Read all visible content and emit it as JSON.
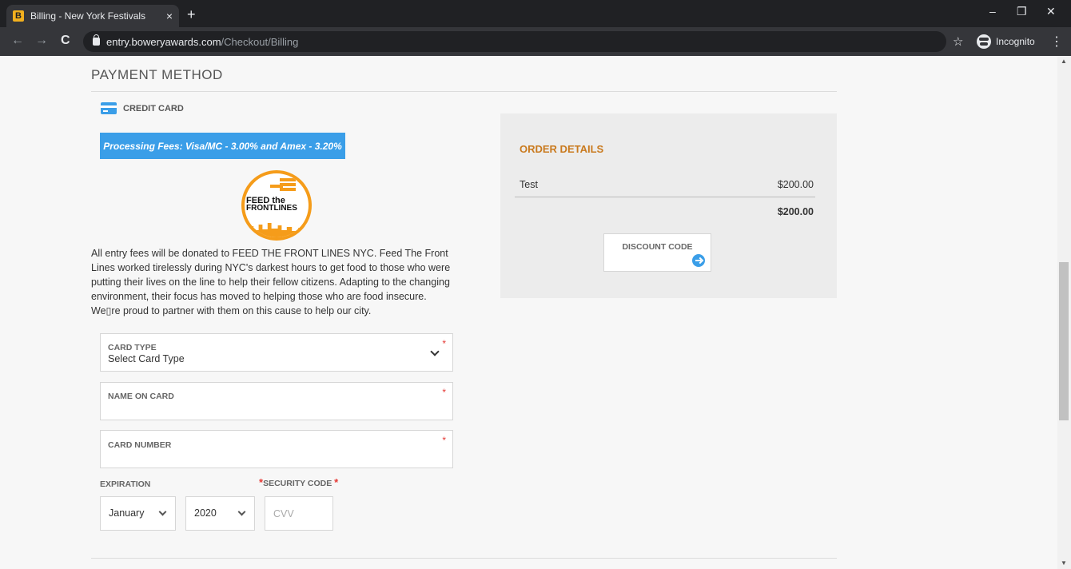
{
  "browser": {
    "tab_title": "Billing - New York Festivals",
    "favicon_letter": "B",
    "tab_close": "×",
    "new_tab": "+",
    "url_host": "entry.boweryawards.com",
    "url_path": "/Checkout/Billing",
    "incognito_label": "Incognito",
    "minimize": "–",
    "maximize": "❐",
    "close": "✕",
    "back": "←",
    "forward": "→",
    "reload": "C",
    "star": "☆",
    "menu": "⋮"
  },
  "payment": {
    "section_title": "PAYMENT METHOD",
    "method_label": "CREDIT CARD",
    "fee_banner": "Processing Fees: Visa/MC - 3.00% and Amex - 3.20%",
    "logo_line1": "FEED the",
    "logo_line2": "FRONTLINES",
    "donation_text": "All entry fees will be donated to FEED THE FRONT LINES NYC. Feed The Front Lines worked tirelessly during NYC's darkest hours to get food to those who were putting their lives on the line to help their fellow citizens. Adapting to the changing environment, their focus has moved to helping those who are food insecure. We▯re proud to partner with them on this cause to help our city.",
    "card_type_label": "CARD TYPE",
    "card_type_value": "Select Card Type",
    "name_label": "NAME ON CARD",
    "number_label": "CARD NUMBER",
    "required_mark": "*",
    "expiration_label": "EXPIRATION",
    "security_label": "SECURITY CODE",
    "month_value": "January",
    "year_value": "2020",
    "cvv_placeholder": "CVV"
  },
  "order": {
    "title": "ORDER DETAILS",
    "item_name": "Test",
    "item_price": "$200.00",
    "total": "$200.00",
    "discount_label": "DISCOUNT CODE"
  },
  "colors": {
    "accent_blue": "#3a9ee8",
    "order_title": "#c97a1e",
    "required_red": "#e53935",
    "logo_orange": "#f59c1a"
  },
  "icons": {
    "card": "credit-card-icon",
    "arrow": "arrow-right-circle-icon",
    "lock": "lock-icon",
    "incognito": "incognito-icon"
  }
}
